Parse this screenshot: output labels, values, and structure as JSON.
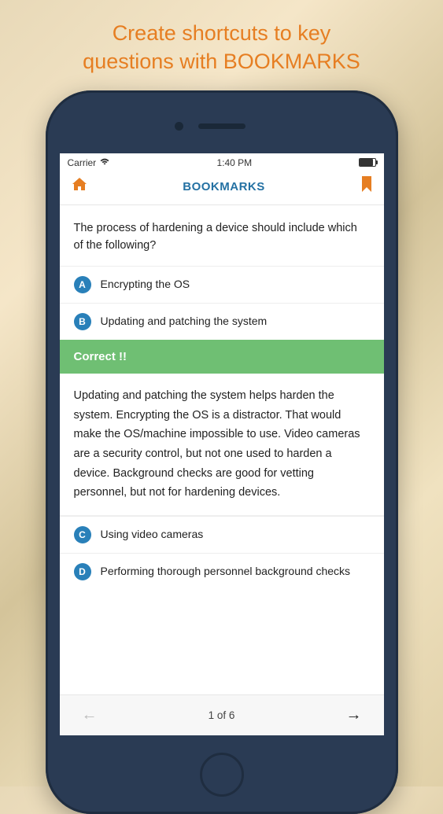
{
  "promo": {
    "line1": "Create shortcuts to key",
    "line2": "questions with BOOKMARKS"
  },
  "statusBar": {
    "carrier": "Carrier",
    "time": "1:40 PM"
  },
  "header": {
    "title": "BOOKMARKS"
  },
  "question": {
    "text": "The process of hardening a device should include which of the following?"
  },
  "options": [
    {
      "letter": "A",
      "text": "Encrypting the OS"
    },
    {
      "letter": "B",
      "text": "Updating and patching the system"
    },
    {
      "letter": "C",
      "text": "Using video cameras"
    },
    {
      "letter": "D",
      "text": "Performing thorough personnel background checks"
    }
  ],
  "correctBanner": "Correct !!",
  "explanation": "Updating and patching the system helps harden the system. Encrypting the OS is a distractor. That would make the OS/machine impossible to use. Video cameras are a security control, but not one used to harden a device. Background checks are good for vetting personnel, but not for hardening devices.",
  "pager": {
    "position": "1 of 6"
  }
}
